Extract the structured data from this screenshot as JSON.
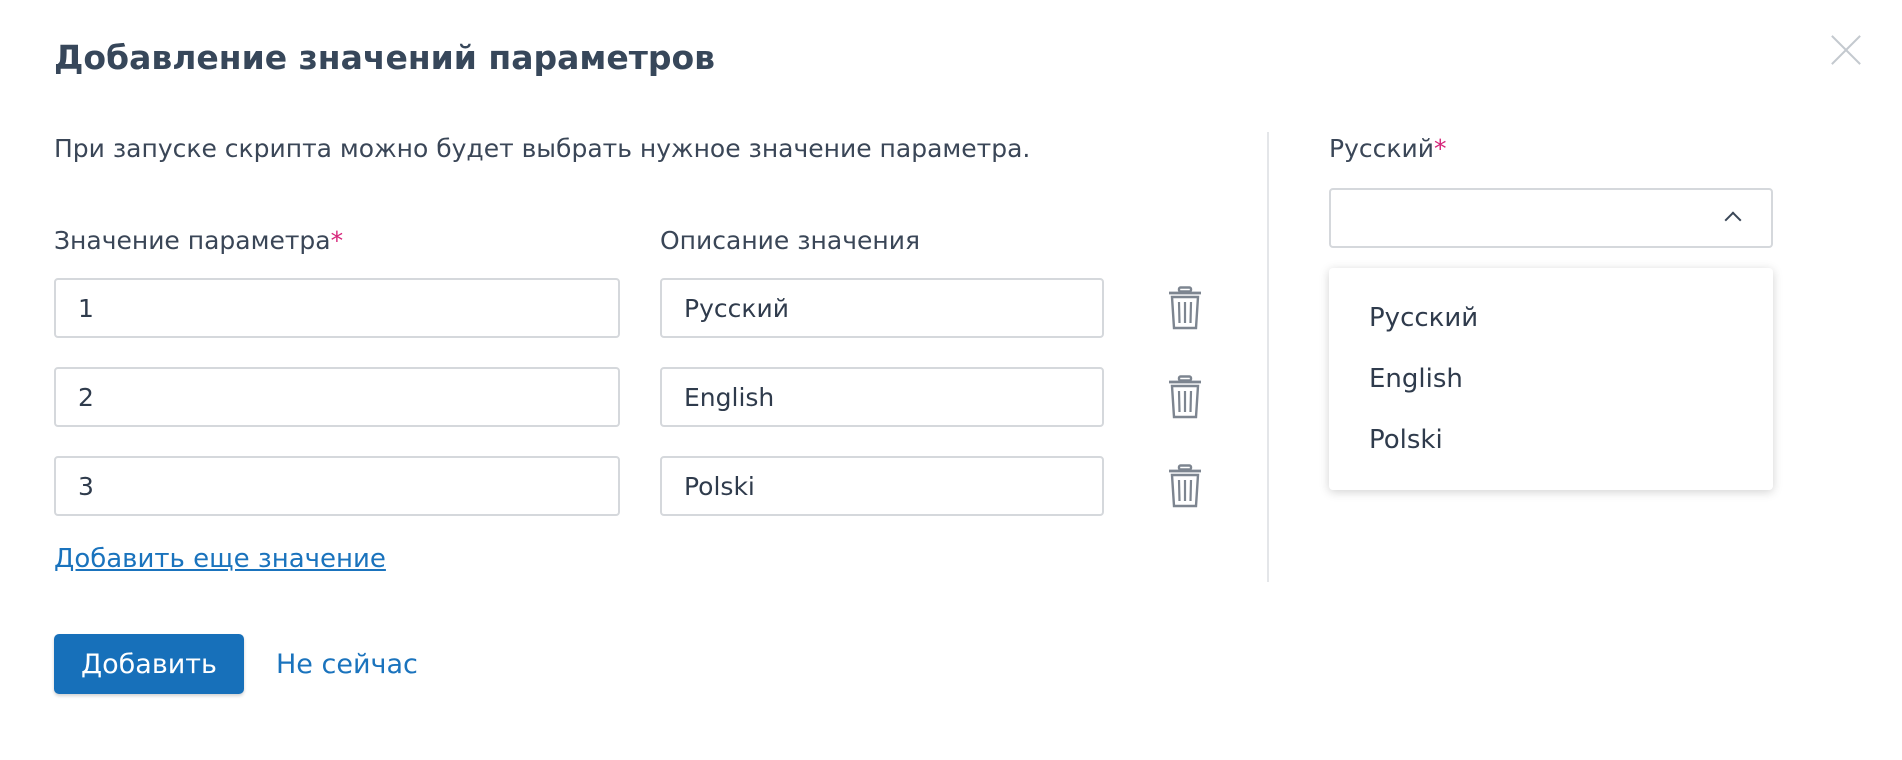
{
  "dialog": {
    "title": "Добавление значений параметров",
    "hint": "При запуске скрипта можно будет выбрать нужное значение параметра.",
    "value_column_label": "Значение параметра",
    "description_column_label": "Описание значения",
    "required_mark": "*",
    "rows": [
      {
        "value": "1",
        "description": "Русский"
      },
      {
        "value": "2",
        "description": "English"
      },
      {
        "value": "3",
        "description": "Polski"
      }
    ],
    "add_value_link": "Добавить еще значение",
    "submit_label": "Добавить",
    "cancel_label": "Не сейчас",
    "close_icon": "close-icon",
    "delete_icon": "trash-icon"
  },
  "select": {
    "label": "Русский",
    "required_mark": "*",
    "value": "",
    "expanded": true,
    "options": [
      "Русский",
      "English",
      "Polski"
    ]
  },
  "colors": {
    "primary": "#1770ba",
    "link": "#1a73bd",
    "required": "#d6247a",
    "text": "#2f3b4c",
    "border": "#d5d8dc"
  }
}
